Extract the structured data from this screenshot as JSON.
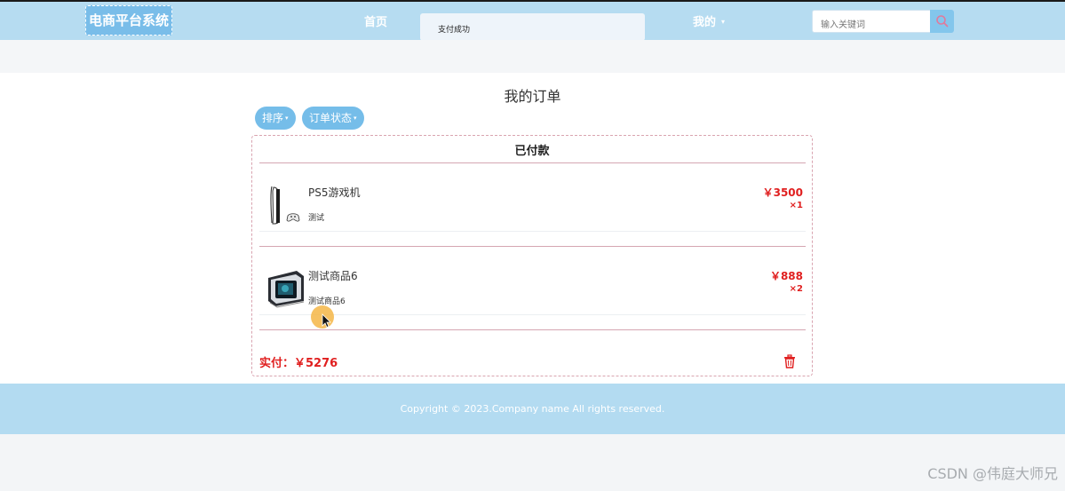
{
  "header": {
    "logo": "电商平台系统",
    "nav_home": "首页",
    "toast": "支付成功",
    "nav_mine": "我的",
    "nav_mine_caret": "▾",
    "search_placeholder": "输入关键词",
    "search_icon": "search-icon"
  },
  "page": {
    "title": "我的订单",
    "sort_label": "排序",
    "status_filter_label": "订单状态",
    "caret": "▾"
  },
  "order": {
    "status": "已付款",
    "items": [
      {
        "name": "PS5游戏机",
        "desc": "测试",
        "price": "￥3500",
        "qty": "×1",
        "thumb_icon": "ps5-console-image"
      },
      {
        "name": "测试商品6",
        "desc": "测试商品6",
        "price": "￥888",
        "qty": "×2",
        "thumb_icon": "cube-pc-image"
      }
    ],
    "paid_label": "实付：￥5276",
    "delete_icon": "trash-icon"
  },
  "footer": {
    "copyright": "Copyright © 2023.Company name All rights reserved."
  },
  "watermark": "CSDN @伟庭大师兄",
  "colors": {
    "header_bg": "#b6dcf1",
    "accent": "#75bde9",
    "price_red": "#e01f1f",
    "footer_bg": "#b3dbf1"
  }
}
